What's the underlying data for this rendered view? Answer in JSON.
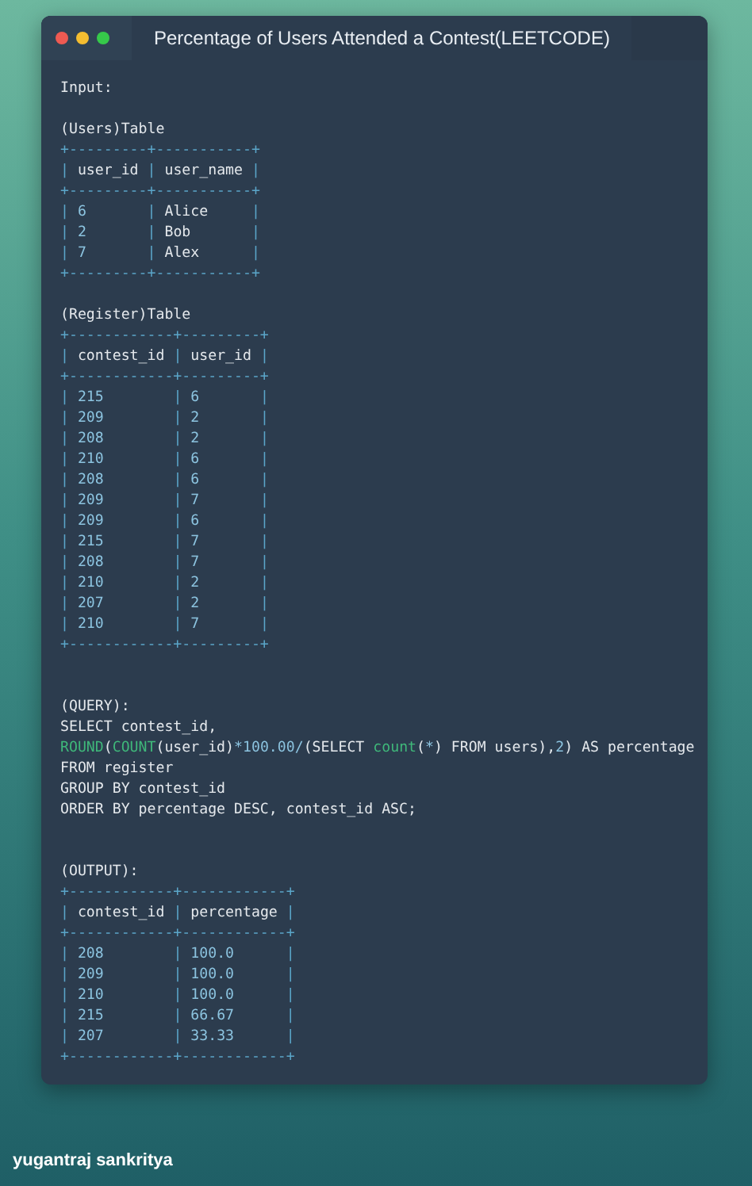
{
  "window": {
    "title": "Percentage of Users Attended a Contest(LEETCODE)"
  },
  "lines": [
    {
      "kind": "code",
      "segments": [
        {
          "kind": "plain",
          "text": "Input:"
        }
      ]
    },
    {
      "kind": "blank"
    },
    {
      "kind": "code",
      "segments": [
        {
          "kind": "plain",
          "text": "(Users)Table"
        }
      ]
    },
    {
      "kind": "code",
      "segments": [
        {
          "kind": "border",
          "text": "+---------+-----------+"
        }
      ]
    },
    {
      "kind": "code",
      "segments": [
        {
          "kind": "border",
          "text": "| "
        },
        {
          "kind": "plain",
          "text": "user_id "
        },
        {
          "kind": "border",
          "text": "| "
        },
        {
          "kind": "plain",
          "text": "user_name "
        },
        {
          "kind": "border",
          "text": "|"
        }
      ]
    },
    {
      "kind": "code",
      "segments": [
        {
          "kind": "border",
          "text": "+---------+-----------+"
        }
      ]
    },
    {
      "kind": "code",
      "segments": [
        {
          "kind": "border",
          "text": "| "
        },
        {
          "kind": "value",
          "text": "6       "
        },
        {
          "kind": "border",
          "text": "| "
        },
        {
          "kind": "plain",
          "text": "Alice     "
        },
        {
          "kind": "border",
          "text": "|"
        }
      ]
    },
    {
      "kind": "code",
      "segments": [
        {
          "kind": "border",
          "text": "| "
        },
        {
          "kind": "value",
          "text": "2       "
        },
        {
          "kind": "border",
          "text": "| "
        },
        {
          "kind": "plain",
          "text": "Bob       "
        },
        {
          "kind": "border",
          "text": "|"
        }
      ]
    },
    {
      "kind": "code",
      "segments": [
        {
          "kind": "border",
          "text": "| "
        },
        {
          "kind": "value",
          "text": "7       "
        },
        {
          "kind": "border",
          "text": "| "
        },
        {
          "kind": "plain",
          "text": "Alex      "
        },
        {
          "kind": "border",
          "text": "|"
        }
      ]
    },
    {
      "kind": "code",
      "segments": [
        {
          "kind": "border",
          "text": "+---------+-----------+"
        }
      ]
    },
    {
      "kind": "blank"
    },
    {
      "kind": "code",
      "segments": [
        {
          "kind": "plain",
          "text": "(Register)Table"
        }
      ]
    },
    {
      "kind": "code",
      "segments": [
        {
          "kind": "border",
          "text": "+------------+---------+"
        }
      ]
    },
    {
      "kind": "code",
      "segments": [
        {
          "kind": "border",
          "text": "| "
        },
        {
          "kind": "plain",
          "text": "contest_id "
        },
        {
          "kind": "border",
          "text": "| "
        },
        {
          "kind": "plain",
          "text": "user_id "
        },
        {
          "kind": "border",
          "text": "|"
        }
      ]
    },
    {
      "kind": "code",
      "segments": [
        {
          "kind": "border",
          "text": "+------------+---------+"
        }
      ]
    },
    {
      "kind": "code",
      "segments": [
        {
          "kind": "border",
          "text": "| "
        },
        {
          "kind": "value",
          "text": "215        "
        },
        {
          "kind": "border",
          "text": "| "
        },
        {
          "kind": "value",
          "text": "6       "
        },
        {
          "kind": "border",
          "text": "|"
        }
      ]
    },
    {
      "kind": "code",
      "segments": [
        {
          "kind": "border",
          "text": "| "
        },
        {
          "kind": "value",
          "text": "209        "
        },
        {
          "kind": "border",
          "text": "| "
        },
        {
          "kind": "value",
          "text": "2       "
        },
        {
          "kind": "border",
          "text": "|"
        }
      ]
    },
    {
      "kind": "code",
      "segments": [
        {
          "kind": "border",
          "text": "| "
        },
        {
          "kind": "value",
          "text": "208        "
        },
        {
          "kind": "border",
          "text": "| "
        },
        {
          "kind": "value",
          "text": "2       "
        },
        {
          "kind": "border",
          "text": "|"
        }
      ]
    },
    {
      "kind": "code",
      "segments": [
        {
          "kind": "border",
          "text": "| "
        },
        {
          "kind": "value",
          "text": "210        "
        },
        {
          "kind": "border",
          "text": "| "
        },
        {
          "kind": "value",
          "text": "6       "
        },
        {
          "kind": "border",
          "text": "|"
        }
      ]
    },
    {
      "kind": "code",
      "segments": [
        {
          "kind": "border",
          "text": "| "
        },
        {
          "kind": "value",
          "text": "208        "
        },
        {
          "kind": "border",
          "text": "| "
        },
        {
          "kind": "value",
          "text": "6       "
        },
        {
          "kind": "border",
          "text": "|"
        }
      ]
    },
    {
      "kind": "code",
      "segments": [
        {
          "kind": "border",
          "text": "| "
        },
        {
          "kind": "value",
          "text": "209        "
        },
        {
          "kind": "border",
          "text": "| "
        },
        {
          "kind": "value",
          "text": "7       "
        },
        {
          "kind": "border",
          "text": "|"
        }
      ]
    },
    {
      "kind": "code",
      "segments": [
        {
          "kind": "border",
          "text": "| "
        },
        {
          "kind": "value",
          "text": "209        "
        },
        {
          "kind": "border",
          "text": "| "
        },
        {
          "kind": "value",
          "text": "6       "
        },
        {
          "kind": "border",
          "text": "|"
        }
      ]
    },
    {
      "kind": "code",
      "segments": [
        {
          "kind": "border",
          "text": "| "
        },
        {
          "kind": "value",
          "text": "215        "
        },
        {
          "kind": "border",
          "text": "| "
        },
        {
          "kind": "value",
          "text": "7       "
        },
        {
          "kind": "border",
          "text": "|"
        }
      ]
    },
    {
      "kind": "code",
      "segments": [
        {
          "kind": "border",
          "text": "| "
        },
        {
          "kind": "value",
          "text": "208        "
        },
        {
          "kind": "border",
          "text": "| "
        },
        {
          "kind": "value",
          "text": "7       "
        },
        {
          "kind": "border",
          "text": "|"
        }
      ]
    },
    {
      "kind": "code",
      "segments": [
        {
          "kind": "border",
          "text": "| "
        },
        {
          "kind": "value",
          "text": "210        "
        },
        {
          "kind": "border",
          "text": "| "
        },
        {
          "kind": "value",
          "text": "2       "
        },
        {
          "kind": "border",
          "text": "|"
        }
      ]
    },
    {
      "kind": "code",
      "segments": [
        {
          "kind": "border",
          "text": "| "
        },
        {
          "kind": "value",
          "text": "207        "
        },
        {
          "kind": "border",
          "text": "| "
        },
        {
          "kind": "value",
          "text": "2       "
        },
        {
          "kind": "border",
          "text": "|"
        }
      ]
    },
    {
      "kind": "code",
      "segments": [
        {
          "kind": "border",
          "text": "| "
        },
        {
          "kind": "value",
          "text": "210        "
        },
        {
          "kind": "border",
          "text": "| "
        },
        {
          "kind": "value",
          "text": "7       "
        },
        {
          "kind": "border",
          "text": "|"
        }
      ]
    },
    {
      "kind": "code",
      "segments": [
        {
          "kind": "border",
          "text": "+------------+---------+"
        }
      ]
    },
    {
      "kind": "blank"
    },
    {
      "kind": "blank"
    },
    {
      "kind": "code",
      "segments": [
        {
          "kind": "plain",
          "text": "(QUERY):"
        }
      ]
    },
    {
      "kind": "code",
      "segments": [
        {
          "kind": "plain",
          "text": "SELECT contest_id,"
        }
      ]
    },
    {
      "kind": "code",
      "segments": [
        {
          "kind": "function",
          "text": "ROUND"
        },
        {
          "kind": "plain",
          "text": "("
        },
        {
          "kind": "function",
          "text": "COUNT"
        },
        {
          "kind": "plain",
          "text": "(user_id)"
        },
        {
          "kind": "value",
          "text": "*100.00/"
        },
        {
          "kind": "plain",
          "text": "(SELECT "
        },
        {
          "kind": "function",
          "text": "count"
        },
        {
          "kind": "plain",
          "text": "("
        },
        {
          "kind": "value",
          "text": "*"
        },
        {
          "kind": "plain",
          "text": ") FROM users),"
        },
        {
          "kind": "value",
          "text": "2"
        },
        {
          "kind": "plain",
          "text": ") AS percentage"
        }
      ]
    },
    {
      "kind": "code",
      "segments": [
        {
          "kind": "plain",
          "text": "FROM register"
        }
      ]
    },
    {
      "kind": "code",
      "segments": [
        {
          "kind": "plain",
          "text": "GROUP BY contest_id"
        }
      ]
    },
    {
      "kind": "code",
      "segments": [
        {
          "kind": "plain",
          "text": "ORDER BY percentage DESC, contest_id ASC;"
        }
      ]
    },
    {
      "kind": "blank"
    },
    {
      "kind": "blank"
    },
    {
      "kind": "code",
      "segments": [
        {
          "kind": "plain",
          "text": "(OUTPUT):"
        }
      ]
    },
    {
      "kind": "code",
      "segments": [
        {
          "kind": "border",
          "text": "+------------+------------+"
        }
      ]
    },
    {
      "kind": "code",
      "segments": [
        {
          "kind": "border",
          "text": "| "
        },
        {
          "kind": "plain",
          "text": "contest_id "
        },
        {
          "kind": "border",
          "text": "| "
        },
        {
          "kind": "plain",
          "text": "percentage "
        },
        {
          "kind": "border",
          "text": "|"
        }
      ]
    },
    {
      "kind": "code",
      "segments": [
        {
          "kind": "border",
          "text": "+------------+------------+"
        }
      ]
    },
    {
      "kind": "code",
      "segments": [
        {
          "kind": "border",
          "text": "| "
        },
        {
          "kind": "value",
          "text": "208        "
        },
        {
          "kind": "border",
          "text": "| "
        },
        {
          "kind": "value",
          "text": "100.0      "
        },
        {
          "kind": "border",
          "text": "|"
        }
      ]
    },
    {
      "kind": "code",
      "segments": [
        {
          "kind": "border",
          "text": "| "
        },
        {
          "kind": "value",
          "text": "209        "
        },
        {
          "kind": "border",
          "text": "| "
        },
        {
          "kind": "value",
          "text": "100.0      "
        },
        {
          "kind": "border",
          "text": "|"
        }
      ]
    },
    {
      "kind": "code",
      "segments": [
        {
          "kind": "border",
          "text": "| "
        },
        {
          "kind": "value",
          "text": "210        "
        },
        {
          "kind": "border",
          "text": "| "
        },
        {
          "kind": "value",
          "text": "100.0      "
        },
        {
          "kind": "border",
          "text": "|"
        }
      ]
    },
    {
      "kind": "code",
      "segments": [
        {
          "kind": "border",
          "text": "| "
        },
        {
          "kind": "value",
          "text": "215        "
        },
        {
          "kind": "border",
          "text": "| "
        },
        {
          "kind": "value",
          "text": "66.67      "
        },
        {
          "kind": "border",
          "text": "|"
        }
      ]
    },
    {
      "kind": "code",
      "segments": [
        {
          "kind": "border",
          "text": "| "
        },
        {
          "kind": "value",
          "text": "207        "
        },
        {
          "kind": "border",
          "text": "| "
        },
        {
          "kind": "value",
          "text": "33.33      "
        },
        {
          "kind": "border",
          "text": "|"
        }
      ]
    },
    {
      "kind": "code",
      "segments": [
        {
          "kind": "border",
          "text": "+------------+------------+"
        }
      ]
    }
  ],
  "author": "yugantraj sankritya"
}
